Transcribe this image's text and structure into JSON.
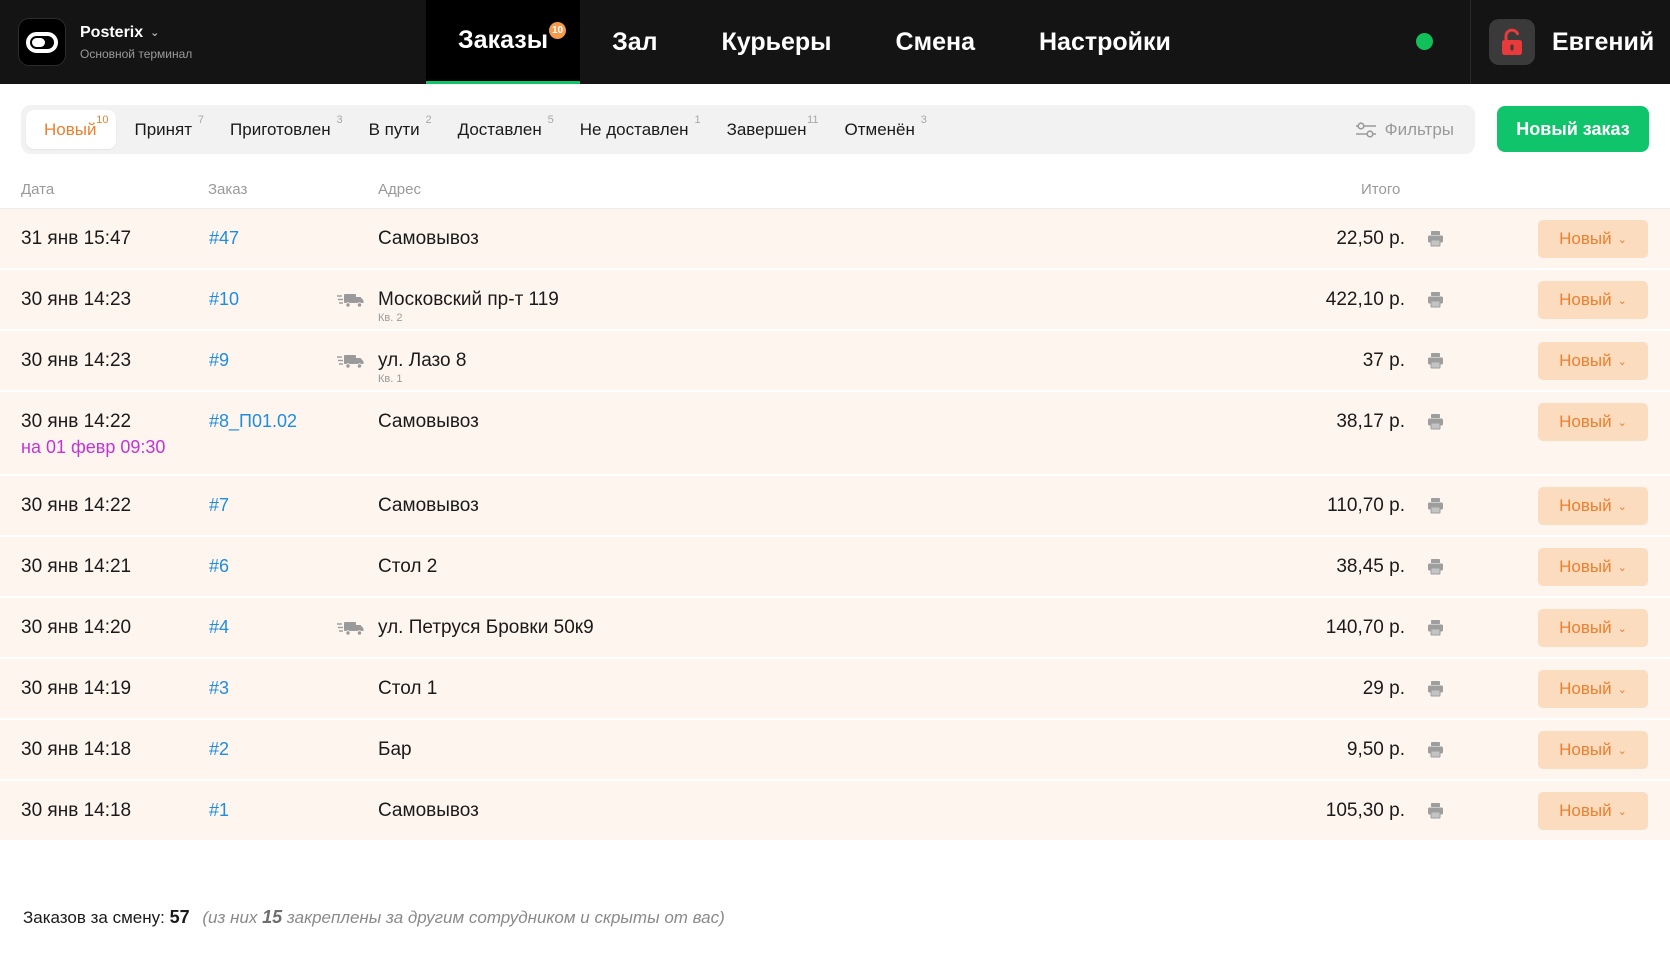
{
  "brand": {
    "name": "Posterix",
    "subtitle": "Основной терминал",
    "logo_icon": "toggle-logo-icon",
    "menu_icon": "chevron-down-icon"
  },
  "nav": {
    "tabs": [
      {
        "label": "Заказы",
        "active": true,
        "badge": "10"
      },
      {
        "label": "Зал",
        "active": false
      },
      {
        "label": "Курьеры",
        "active": false
      },
      {
        "label": "Смена",
        "active": false
      },
      {
        "label": "Настройки",
        "active": false
      }
    ]
  },
  "user": {
    "name": "Евгений",
    "online_color": "#11c05a",
    "lock_icon": "lock-open-icon",
    "lock_color": "#e83a3a"
  },
  "status_tabs": [
    {
      "label": "Новый",
      "count": "10",
      "active": true
    },
    {
      "label": "Принят",
      "count": "7"
    },
    {
      "label": "Приготовлен",
      "count": "3"
    },
    {
      "label": "В пути",
      "count": "2"
    },
    {
      "label": "Доставлен",
      "count": "5"
    },
    {
      "label": "Не доставлен",
      "count": "1"
    },
    {
      "label": "Завершен",
      "count": "11"
    },
    {
      "label": "Отменён",
      "count": "3"
    }
  ],
  "filters_label": "Фильтры",
  "new_order_label": "Новый заказ",
  "columns": {
    "date": "Дата",
    "order": "Заказ",
    "address": "Адрес",
    "total": "Итого"
  },
  "orders": [
    {
      "date": "31 янв 15:47",
      "number": "#47",
      "delivery": false,
      "address": "Самовывоз",
      "total": "22,50 р.",
      "status": "Новый"
    },
    {
      "date": "30 янв 14:23",
      "number": "#10",
      "delivery": true,
      "address": "Московский пр-т 119",
      "apt": "Кв. 2",
      "total": "422,10 р.",
      "status": "Новый"
    },
    {
      "date": "30 янв 14:23",
      "number": "#9",
      "delivery": true,
      "address": "ул. Лазо 8",
      "apt": "Кв. 1",
      "total": "37 р.",
      "status": "Новый"
    },
    {
      "date": "30 янв 14:22",
      "scheduled": "на 01 февр 09:30",
      "number": "#8_П01.02",
      "delivery": false,
      "address": "Самовывоз",
      "total": "38,17 р.",
      "status": "Новый"
    },
    {
      "date": "30 янв 14:22",
      "number": "#7",
      "delivery": false,
      "address": "Самовывоз",
      "total": "110,70 р.",
      "status": "Новый"
    },
    {
      "date": "30 янв 14:21",
      "number": "#6",
      "delivery": false,
      "address": "Стол 2",
      "total": "38,45 р.",
      "status": "Новый"
    },
    {
      "date": "30 янв 14:20",
      "number": "#4",
      "delivery": true,
      "address": "ул. Петруся Бровки 50к9",
      "total": "140,70 р.",
      "status": "Новый"
    },
    {
      "date": "30 янв 14:19",
      "number": "#3",
      "delivery": false,
      "address": "Стол 1",
      "total": "29 р.",
      "status": "Новый"
    },
    {
      "date": "30 янв 14:18",
      "number": "#2",
      "delivery": false,
      "address": "Бар",
      "total": "9,50 р.",
      "status": "Новый"
    },
    {
      "date": "30 янв 14:18",
      "number": "#1",
      "delivery": false,
      "address": "Самовывоз",
      "total": "105,30 р.",
      "status": "Новый"
    }
  ],
  "footer": {
    "label": "Заказов за смену:",
    "count": "57",
    "note_prefix": "(из них",
    "note_count": "15",
    "note_suffix": "закреплены за другим сотрудником и скрыты от вас)"
  },
  "colors": {
    "accent_orange": "#ee7f2f",
    "green": "#10c46b",
    "link_blue": "#1f8de0",
    "scheduled_purple": "#c134d8",
    "row_bg": "#fdf5ee"
  }
}
